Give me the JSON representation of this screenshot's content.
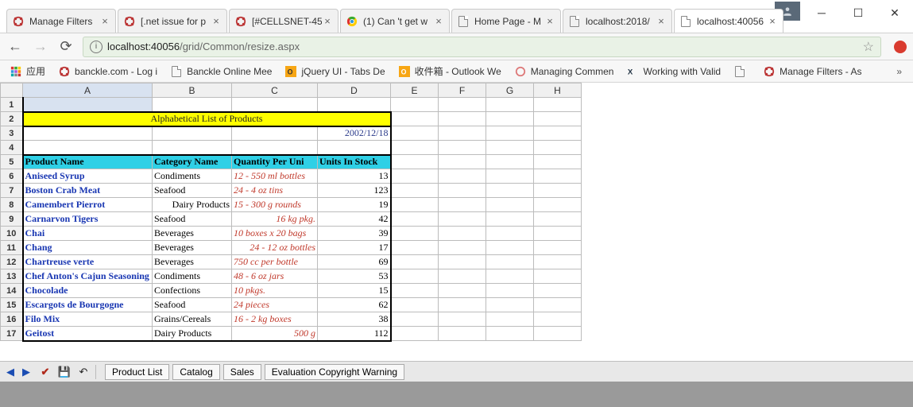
{
  "window": {
    "avatar_icon": "person"
  },
  "tabs": [
    {
      "title": "Manage Filters",
      "icon": "aspose"
    },
    {
      "title": "[.net issue for p",
      "icon": "aspose"
    },
    {
      "title": "[#CELLSNET-45",
      "icon": "aspose"
    },
    {
      "title": "(1) Can 't get w",
      "icon": "chrome"
    },
    {
      "title": "Home Page - M",
      "icon": "file"
    },
    {
      "title": "localhost:2018/",
      "icon": "file"
    },
    {
      "title": "localhost:40056",
      "icon": "file",
      "active": true
    }
  ],
  "url": {
    "host": "localhost",
    "port": ":40056",
    "path": "/grid/Common/resize.aspx"
  },
  "bookmarks": {
    "apps": "应用",
    "items": [
      {
        "label": "banckle.com - Log i",
        "icon": "aspose"
      },
      {
        "label": "Banckle Online Mee",
        "icon": "file"
      },
      {
        "label": "jQuery UI - Tabs De",
        "icon": "jq"
      },
      {
        "label": "收件箱 - Outlook We",
        "icon": "outlook"
      },
      {
        "label": "Managing Commen",
        "icon": "swirl"
      },
      {
        "label": "Working with Valid",
        "icon": "xv"
      },
      {
        "label": "",
        "icon": "file"
      },
      {
        "label": "Manage Filters - As",
        "icon": "aspose"
      }
    ]
  },
  "sheet": {
    "columns": [
      "A",
      "B",
      "C",
      "D",
      "E",
      "F",
      "G",
      "H"
    ],
    "title": "Alphabetical List of Products",
    "date": "2002/12/18",
    "headers": {
      "a": "Product Name",
      "b": "Category Name",
      "c": "Quantity Per Uni",
      "d": "Units In Stock"
    },
    "rows": [
      {
        "n": "Aniseed Syrup",
        "cat": "Condiments",
        "q": "12 - 550 ml bottles",
        "s": "13"
      },
      {
        "n": "Boston Crab Meat",
        "cat": "Seafood",
        "q": "24 - 4 oz tins",
        "s": "123"
      },
      {
        "n": "Camembert Pierrot",
        "cat": "Dairy Products",
        "q": "15 - 300 g rounds",
        "s": "19",
        "catR": true
      },
      {
        "n": "Carnarvon Tigers",
        "cat": "Seafood",
        "q": "16 kg pkg.",
        "s": "42",
        "qR": true
      },
      {
        "n": "Chai",
        "cat": "Beverages",
        "q": "10 boxes x 20 bags",
        "s": "39"
      },
      {
        "n": "Chang",
        "cat": "Beverages",
        "q": "24 - 12 oz bottles",
        "s": "17",
        "qR": true
      },
      {
        "n": "Chartreuse verte",
        "cat": "Beverages",
        "q": "750 cc per bottle",
        "s": "69"
      },
      {
        "n": "Chef Anton's Cajun Seasoning",
        "cat": "Condiments",
        "q": "48 - 6 oz jars",
        "s": "53"
      },
      {
        "n": "Chocolade",
        "cat": "Confections",
        "q": "10 pkgs.",
        "s": "15"
      },
      {
        "n": "Escargots de Bourgogne",
        "cat": "Seafood",
        "q": "24 pieces",
        "s": "62"
      },
      {
        "n": "Filo Mix",
        "cat": "Grains/Cereals",
        "q": "16 - 2 kg boxes",
        "s": "38"
      },
      {
        "n": "Geitost",
        "cat": "Dairy Products",
        "q": "500 g",
        "s": "112",
        "qR": true
      }
    ],
    "tabs": [
      "Product List",
      "Catalog",
      "Sales",
      "Evaluation Copyright Warning"
    ]
  },
  "chart_data": {
    "type": "table",
    "title": "Alphabetical List of Products",
    "date": "2002/12/18",
    "columns": [
      "Product Name",
      "Category Name",
      "Quantity Per Unit",
      "Units In Stock"
    ],
    "rows": [
      [
        "Aniseed Syrup",
        "Condiments",
        "12 - 550 ml bottles",
        13
      ],
      [
        "Boston Crab Meat",
        "Seafood",
        "24 - 4 oz tins",
        123
      ],
      [
        "Camembert Pierrot",
        "Dairy Products",
        "15 - 300 g rounds",
        19
      ],
      [
        "Carnarvon Tigers",
        "Seafood",
        "16 kg pkg.",
        42
      ],
      [
        "Chai",
        "Beverages",
        "10 boxes x 20 bags",
        39
      ],
      [
        "Chang",
        "Beverages",
        "24 - 12 oz bottles",
        17
      ],
      [
        "Chartreuse verte",
        "Beverages",
        "750 cc per bottle",
        69
      ],
      [
        "Chef Anton's Cajun Seasoning",
        "Condiments",
        "48 - 6 oz jars",
        53
      ],
      [
        "Chocolade",
        "Confections",
        "10 pkgs.",
        15
      ],
      [
        "Escargots de Bourgogne",
        "Seafood",
        "24 pieces",
        62
      ],
      [
        "Filo Mix",
        "Grains/Cereals",
        "16 - 2 kg boxes",
        38
      ],
      [
        "Geitost",
        "Dairy Products",
        "500 g",
        112
      ]
    ]
  }
}
